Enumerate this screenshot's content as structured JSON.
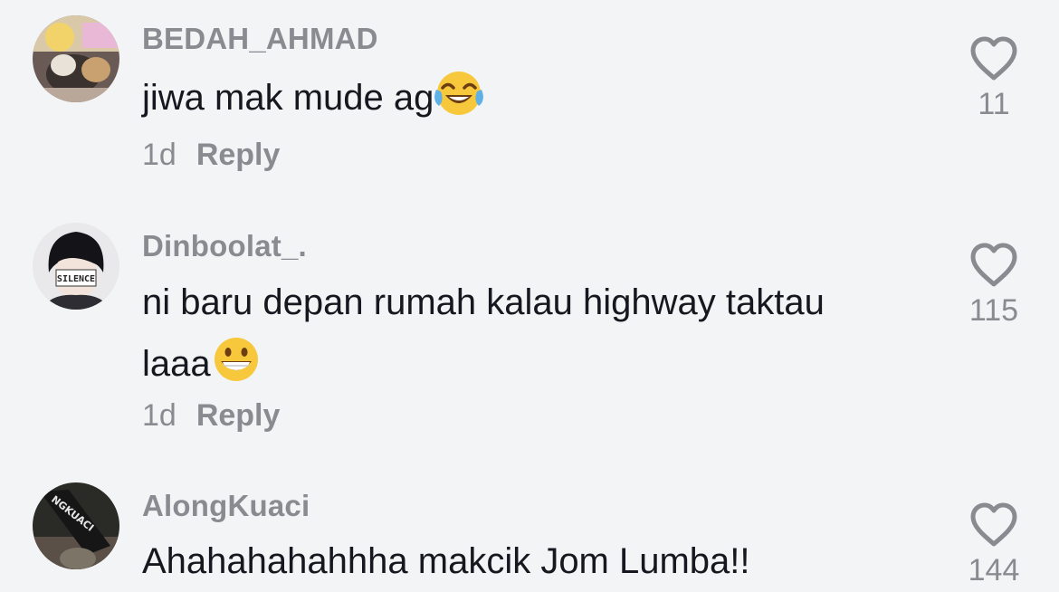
{
  "comments": [
    {
      "username": "BEDAH_AHMAD",
      "text": "jiwa mak mude ag",
      "emoji": "tears-of-joy",
      "time": "1d",
      "reply_label": "Reply",
      "likes": "11"
    },
    {
      "username": "Dinboolat_.",
      "text_line1": "ni baru depan rumah kalau highway taktau",
      "text_line2": "laaa",
      "emoji": "grinning",
      "time": "1d",
      "reply_label": "Reply",
      "likes": "115"
    },
    {
      "username": "AlongKuaci",
      "text": "Ahahahahahhha makcik Jom Lumba!!",
      "likes": "144"
    }
  ],
  "avatar_texts": {
    "c2": "SILENCE",
    "c3": "NGKUACI"
  },
  "colors": {
    "background": "#f3f4f6",
    "text": "#16181f",
    "muted": "#8a8b91"
  }
}
